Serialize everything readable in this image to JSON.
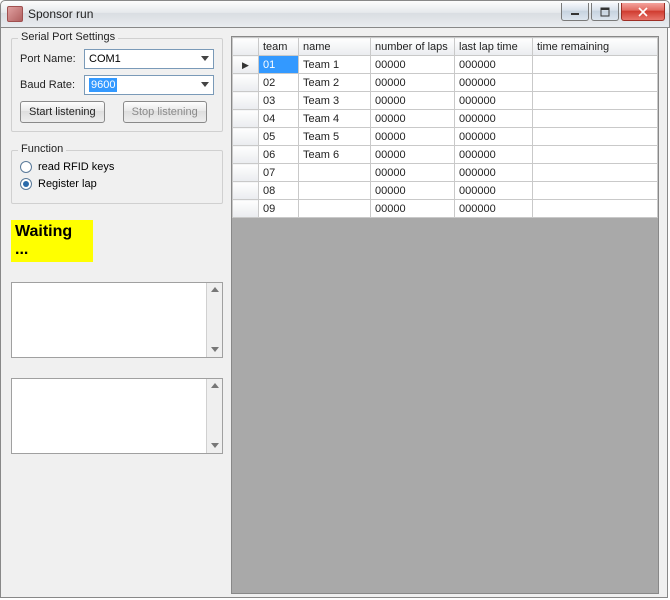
{
  "window": {
    "title": "Sponsor run"
  },
  "serial": {
    "groupTitle": "Serial Port Settings",
    "portLabel": "Port Name:",
    "portValue": "COM1",
    "baudLabel": "Baud Rate:",
    "baudValue": "9600",
    "startLabel": "Start listening",
    "stopLabel": "Stop listening"
  },
  "function": {
    "groupTitle": "Function",
    "readLabel": "read RFID keys",
    "registerLabel": "Register lap",
    "selected": "register"
  },
  "status": {
    "text": "Waiting ..."
  },
  "grid": {
    "headers": {
      "team": "team",
      "name": "name",
      "laps": "number of laps",
      "last": "last lap time",
      "remaining": "time remaining"
    },
    "rows": [
      {
        "team": "01",
        "name": "Team 1",
        "laps": "00000",
        "last": "000000",
        "remaining": ""
      },
      {
        "team": "02",
        "name": "Team 2",
        "laps": "00000",
        "last": "000000",
        "remaining": ""
      },
      {
        "team": "03",
        "name": "Team 3",
        "laps": "00000",
        "last": "000000",
        "remaining": ""
      },
      {
        "team": "04",
        "name": "Team 4",
        "laps": "00000",
        "last": "000000",
        "remaining": ""
      },
      {
        "team": "05",
        "name": "Team 5",
        "laps": "00000",
        "last": "000000",
        "remaining": ""
      },
      {
        "team": "06",
        "name": "Team 6",
        "laps": "00000",
        "last": "000000",
        "remaining": ""
      },
      {
        "team": "07",
        "name": "",
        "laps": "00000",
        "last": "000000",
        "remaining": ""
      },
      {
        "team": "08",
        "name": "",
        "laps": "00000",
        "last": "000000",
        "remaining": ""
      },
      {
        "team": "09",
        "name": "",
        "laps": "00000",
        "last": "000000",
        "remaining": ""
      }
    ]
  }
}
